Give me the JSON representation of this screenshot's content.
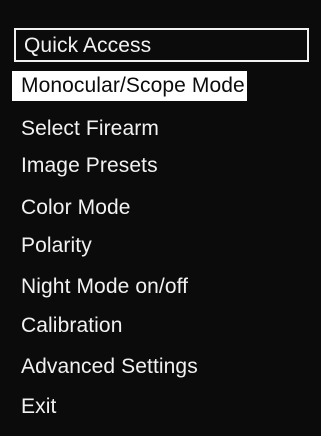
{
  "menu": {
    "header": "Quick Access",
    "selected": "Monocular/Scope Mode",
    "items": [
      "Select Firearm",
      "Image Presets",
      "Color Mode",
      "Polarity",
      "Night Mode on/off",
      "Calibration",
      "Advanced Settings",
      "Exit"
    ]
  },
  "colors": {
    "background": "#0b0b0b",
    "text": "#f2f2f2",
    "highlight": "#ffffff"
  }
}
